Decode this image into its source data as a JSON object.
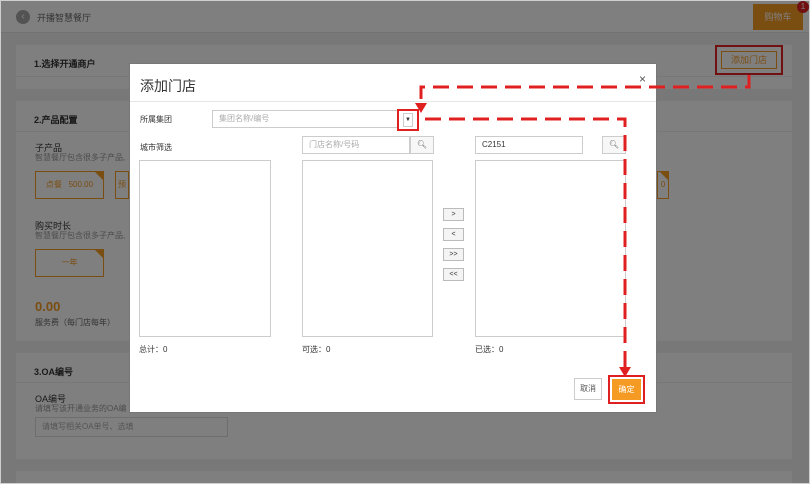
{
  "header": {
    "page_title": "开播智慧餐厅",
    "cart_label": "购物车",
    "cart_badge": "1"
  },
  "section1": {
    "title": "1.选择开通商户",
    "add_store_label": "添加门店"
  },
  "section2": {
    "title": "2.产品配置",
    "subproduct_label": "子产品",
    "subproduct_hint": "智慧餐厅包含很多子产品,",
    "option1": "点餐",
    "option1_price": "500.00",
    "option2_partial": "预",
    "option3_partial": "0",
    "duration_label": "购买时长",
    "duration_hint": "智慧餐厅包含很多子产品,",
    "duration_option": "一年",
    "price": "0.00",
    "price_label": "服务费（每门店每年）"
  },
  "section3": {
    "title": "3.OA编号",
    "oa_label": "OA编号",
    "oa_hint": "请填写该开通业务的OA编",
    "oa_placeholder": "请填写相关OA单号、选填"
  },
  "modal": {
    "title": "添加门店",
    "close": "×",
    "group_label": "所属集团",
    "group_placeholder": "集团名称/编号",
    "city_label": "城市筛选",
    "store_search_placeholder": "门店名称/号码",
    "selected_search_value": "C2151",
    "btn_move_right": ">",
    "btn_move_left": "<",
    "btn_move_all_right": ">>",
    "btn_move_all_left": "<<",
    "total_label": "总计：0",
    "available_label": "可选：0",
    "selected_label": "已选：0",
    "cancel_label": "取消",
    "confirm_label": "确定"
  },
  "colors": {
    "accent": "#f59a23",
    "highlight": "#e02020",
    "overlay": "rgba(0,0,0,0.5)"
  },
  "icons": {
    "back": "chevron-left-icon",
    "search": "search-icon",
    "dropdown": "caret-down-icon"
  }
}
